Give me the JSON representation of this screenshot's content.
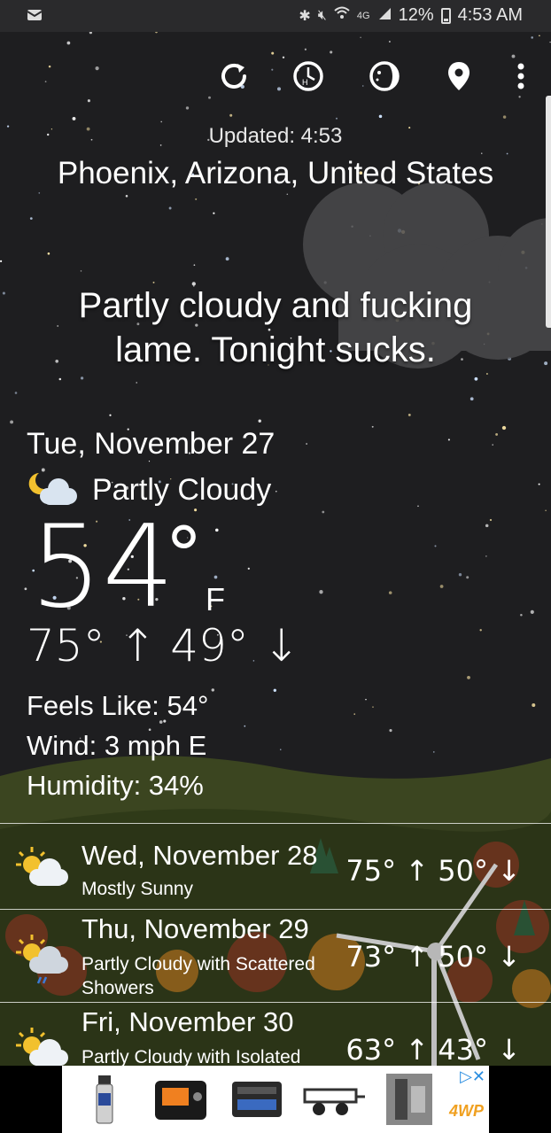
{
  "status_bar": {
    "battery": "12%",
    "time": "4:53 AM",
    "network": "4G"
  },
  "toolbar": {
    "icons": [
      "refresh-icon",
      "hourly-clock-icon",
      "moon-phase-icon",
      "location-pin-icon",
      "more-vert-icon"
    ]
  },
  "header": {
    "updated": "Updated: 4:53",
    "location": "Phoenix, Arizona, United States"
  },
  "quip": "Partly cloudy and fucking lame. Tonight sucks.",
  "current": {
    "date": "Tue, November 27",
    "condition": "Partly Cloudy",
    "temp": "54",
    "degree": "°",
    "unit": "F",
    "hilo": "75° ↑ 49° ↓",
    "feels_like": "Feels Like: 54°",
    "wind": "Wind: 3 mph E",
    "humidity": "Humidity: 34%"
  },
  "forecast": [
    {
      "date": "Wed, November 28",
      "condition": "Mostly Sunny",
      "temps": "75° ↑ 50° ↓",
      "icon": "sun-cloud-icon"
    },
    {
      "date": "Thu, November 29",
      "condition": "Partly Cloudy with Scattered Showers",
      "temps": "73° ↑ 50° ↓",
      "icon": "sun-cloud-rain-icon"
    },
    {
      "date": "Fri, November 30",
      "condition": "Partly Cloudy with Isolated",
      "temps": "63° ↑ 43° ↓",
      "icon": "sun-cloud-icon"
    }
  ],
  "ad": {
    "brand": "4WP"
  },
  "colors": {
    "sky": "#1e1e20",
    "hill": "#3d4a1e",
    "accent_ad": "#2a8de0"
  }
}
